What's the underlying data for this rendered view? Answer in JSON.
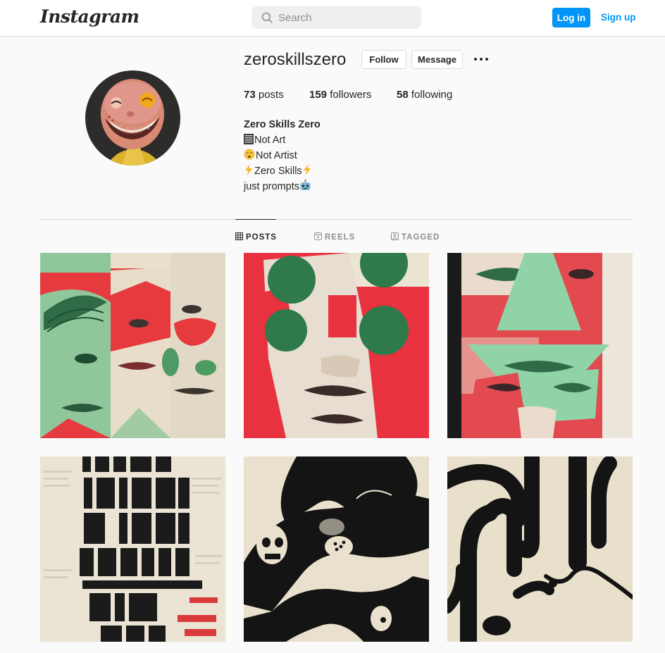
{
  "header": {
    "logo_text": "Instagram",
    "search_placeholder": "Search",
    "login_label": "Log in",
    "signup_label": "Sign up"
  },
  "profile": {
    "username": "zeroskillszero",
    "follow_label": "Follow",
    "message_label": "Message",
    "stats": {
      "posts_count": "73",
      "posts_label": " posts",
      "followers_count": "159",
      "followers_label": " followers",
      "following_count": "58",
      "following_label": " following"
    },
    "bio": {
      "name": "Zero Skills Zero",
      "line1": "Not Art",
      "line2": "Not Artist",
      "line3": "Zero Skills",
      "line4": "just prompts"
    }
  },
  "tabs": [
    {
      "label": "POSTS",
      "icon": "grid-icon",
      "active": true
    },
    {
      "label": "REELS",
      "icon": "reels-icon",
      "active": false
    },
    {
      "label": "TAGGED",
      "icon": "tagged-icon",
      "active": false
    }
  ],
  "posts": [
    {
      "theme": "red-green-face-collage"
    },
    {
      "theme": "red-face-green-circles"
    },
    {
      "theme": "green-triangle-faces"
    },
    {
      "theme": "this-is-not-art-typography"
    },
    {
      "theme": "skull-black-ink-swirl"
    },
    {
      "theme": "black-ink-tubes"
    }
  ],
  "colors": {
    "accent": "#0095f6",
    "text": "#262626",
    "muted": "#8e8e8e",
    "border": "#dbdbdb",
    "collage_red": "#e8323f",
    "collage_green": "#8fc79a",
    "paper": "#ece4d3"
  }
}
